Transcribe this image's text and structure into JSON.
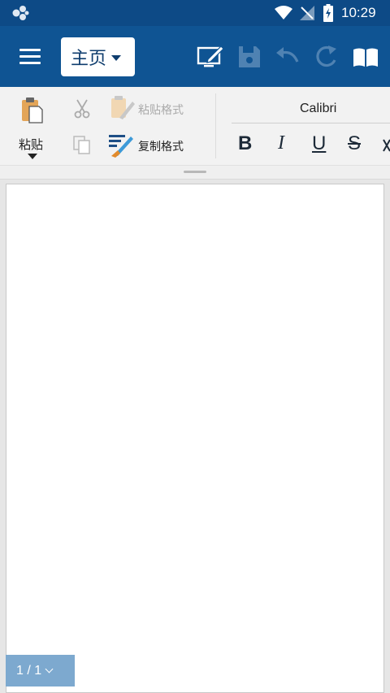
{
  "status_bar": {
    "time": "10:29",
    "icons": [
      "app-glyph-icon",
      "wifi-icon",
      "signal-icon",
      "battery-charging-icon"
    ]
  },
  "app_bar": {
    "tab_label": "主页",
    "icons": [
      "menu-icon",
      "edit-screen-icon",
      "save-icon",
      "undo-icon",
      "redo-icon",
      "read-mode-icon"
    ],
    "colors": {
      "background": "#0f5493",
      "status_bar": "#0d4a86"
    }
  },
  "ribbon": {
    "paste_label": "粘贴",
    "paste_format_label": "粘贴格式",
    "copy_format_label": "复制格式",
    "font_name": "Calibri",
    "bold": "B",
    "italic": "I",
    "underline": "U",
    "strike": "S"
  },
  "document": {
    "page_indicator": "1 / 1"
  }
}
